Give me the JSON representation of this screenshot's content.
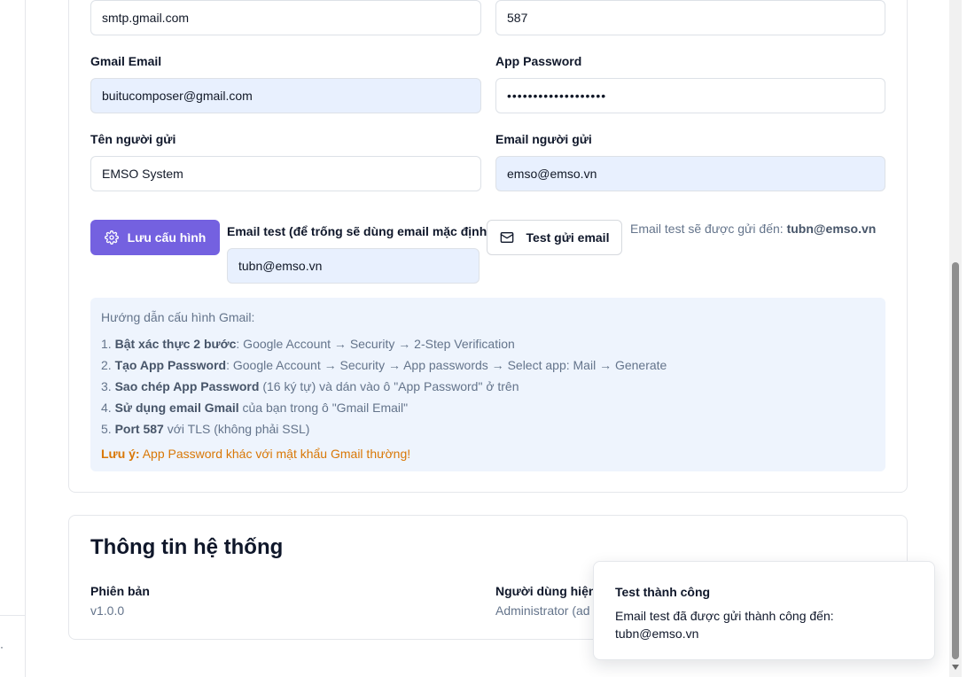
{
  "smtp": {
    "host_value": "smtp.gmail.com",
    "port_value": "587",
    "gmail_email_label": "Gmail Email",
    "gmail_email_value": "buitucomposer@gmail.com",
    "app_password_label": "App Password",
    "app_password_value": "•••••••••••••••••••",
    "sender_name_label": "Tên người gửi",
    "sender_name_value": "EMSO System",
    "sender_email_label": "Email người gửi",
    "sender_email_value": "emso@emso.vn"
  },
  "actions": {
    "save_label": "Lưu cấu hình",
    "test_email_label": "Email test (để trống sẽ dùng email mặc định)",
    "test_email_value": "tubn@emso.vn",
    "send_test_label": "Test gửi email",
    "hint_prefix": "Email test sẽ được gửi đến:",
    "hint_email": "tubn@emso.vn"
  },
  "guide": {
    "title": "Hướng dẫn cấu hình Gmail:",
    "steps": [
      {
        "num": "1.",
        "bold": "Bật xác thực 2 bước",
        "rest": ": Google Account → Security → 2-Step Verification"
      },
      {
        "num": "2.",
        "bold": "Tạo App Password",
        "rest": ": Google Account → Security → App passwords → Select app: Mail → Generate"
      },
      {
        "num": "3.",
        "bold": "Sao chép App Password",
        "rest": " (16 ký tự) và dán vào ô \"App Password\" ở trên"
      },
      {
        "num": "4.",
        "bold": "Sử dụng email Gmail",
        "rest": " của bạn trong ô \"Gmail Email\""
      },
      {
        "num": "5.",
        "bold": "Port 587",
        "rest": " với TLS (không phải SSL)"
      }
    ],
    "note_label": "Lưu ý:",
    "note_text": " App Password khác với mật khẩu Gmail thường!"
  },
  "system_info": {
    "title": "Thông tin hệ thống",
    "version_label": "Phiên bản",
    "version_value": "v1.0.0",
    "current_user_label": "Người dùng hiện",
    "current_user_value": "Administrator (ad"
  },
  "toast": {
    "title": "Test thành công",
    "message": "Email test đã được gửi thành công đến: tubn@emso.vn"
  },
  "icons": {
    "save": "gear-icon",
    "send": "mail-icon"
  },
  "colors": {
    "primary": "#7461e0",
    "autofill_bg": "#e8f0fe",
    "guide_bg": "#eef4fd",
    "warning": "#d97706"
  }
}
